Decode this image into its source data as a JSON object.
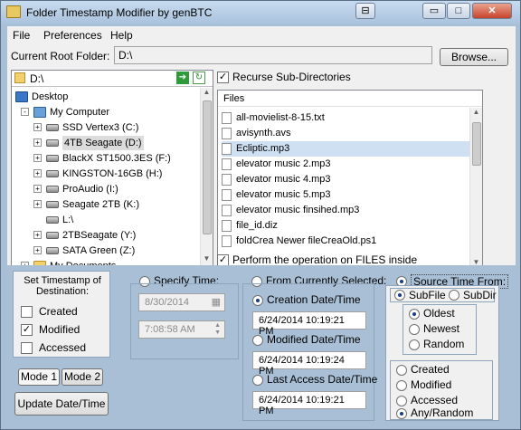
{
  "window": {
    "title": "Folder Timestamp Modifier by genBTC",
    "btn_min": "▭",
    "btn_max": "□",
    "btn_close": "✕",
    "btn_extra": "⊟"
  },
  "menu": [
    "File",
    "Preferences",
    "Help"
  ],
  "root": {
    "label": "Current Root Folder:",
    "value": "D:\\",
    "browse": "Browse..."
  },
  "path": {
    "value": "D:\\"
  },
  "tree": [
    {
      "label": "Desktop",
      "indent": 0,
      "icon": "desktop-icon",
      "exp": false
    },
    {
      "label": "My Computer",
      "indent": 1,
      "icon": "computer-icon",
      "exp": "-"
    },
    {
      "label": "SSD Vertex3 (C:)",
      "indent": 2,
      "icon": "drive-icon",
      "exp": "+"
    },
    {
      "label": "4TB Seagate (D:)",
      "indent": 2,
      "icon": "drive-icon",
      "exp": "+",
      "selected": true
    },
    {
      "label": "BlackX ST1500.3ES (F:)",
      "indent": 2,
      "icon": "drive-icon",
      "exp": "+"
    },
    {
      "label": "KINGSTON-16GB (H:)",
      "indent": 2,
      "icon": "drive-icon",
      "exp": "+"
    },
    {
      "label": "ProAudio (I:)",
      "indent": 2,
      "icon": "drive-icon",
      "exp": "+"
    },
    {
      "label": "Seagate 2TB (K:)",
      "indent": 2,
      "icon": "drive-icon",
      "exp": "+"
    },
    {
      "label": "L:\\",
      "indent": 2,
      "icon": "network-drive-icon",
      "exp": false
    },
    {
      "label": "2TBSeagate (Y:)",
      "indent": 2,
      "icon": "drive-icon",
      "exp": "+"
    },
    {
      "label": "SATA Green (Z:)",
      "indent": 2,
      "icon": "drive-icon",
      "exp": "+"
    },
    {
      "label": "My Documents",
      "indent": 1,
      "icon": "folder-icon",
      "exp": "+"
    }
  ],
  "recurse": {
    "label": "Recurse Sub-Directories",
    "checked": true
  },
  "files": {
    "header": "Files",
    "items": [
      {
        "name": "all-movielist-8-15.txt",
        "selected": false
      },
      {
        "name": "avisynth.avs",
        "selected": false
      },
      {
        "name": "Ecliptic.mp3",
        "selected": true
      },
      {
        "name": "elevator music 2.mp3",
        "selected": false
      },
      {
        "name": "elevator music 4.mp3",
        "selected": false
      },
      {
        "name": "elevator music 5.mp3",
        "selected": false
      },
      {
        "name": "elevator music finsihed.mp3",
        "selected": false
      },
      {
        "name": "file_id.diz",
        "selected": false
      },
      {
        "name": "foldCrea Newer fileCreaOld.ps1",
        "selected": false
      }
    ]
  },
  "perform": {
    "label": "Perform the operation on FILES inside",
    "checked": true
  },
  "destination": {
    "title": "Set Timestamp of Destination:",
    "options": [
      {
        "label": "Created",
        "checked": false
      },
      {
        "label": "Modified",
        "checked": true
      },
      {
        "label": "Accessed",
        "checked": false
      }
    ]
  },
  "modes": [
    "Mode 1",
    "Mode 2"
  ],
  "update_button": "Update Date/Time",
  "specify": {
    "label": "Specify Time:",
    "date": "8/30/2014",
    "time": "7:08:58 AM"
  },
  "from_selected": {
    "label": "From Currently Selected:",
    "creation_label": "Creation Date/Time",
    "creation": "6/24/2014 10:19:21 PM",
    "modified_label": "Modified Date/Time",
    "modified": "6/24/2014 10:19:24 PM",
    "access_label": "Last Access Date/Time",
    "access": "6/24/2014 10:19:21 PM"
  },
  "source": {
    "label": "Source Time From:",
    "subfile": "SubFile",
    "subdir": "SubDir",
    "age": [
      "Oldest",
      "Newest",
      "Random"
    ],
    "type": [
      "Created",
      "Modified",
      "Accessed",
      "Any/Random"
    ]
  }
}
